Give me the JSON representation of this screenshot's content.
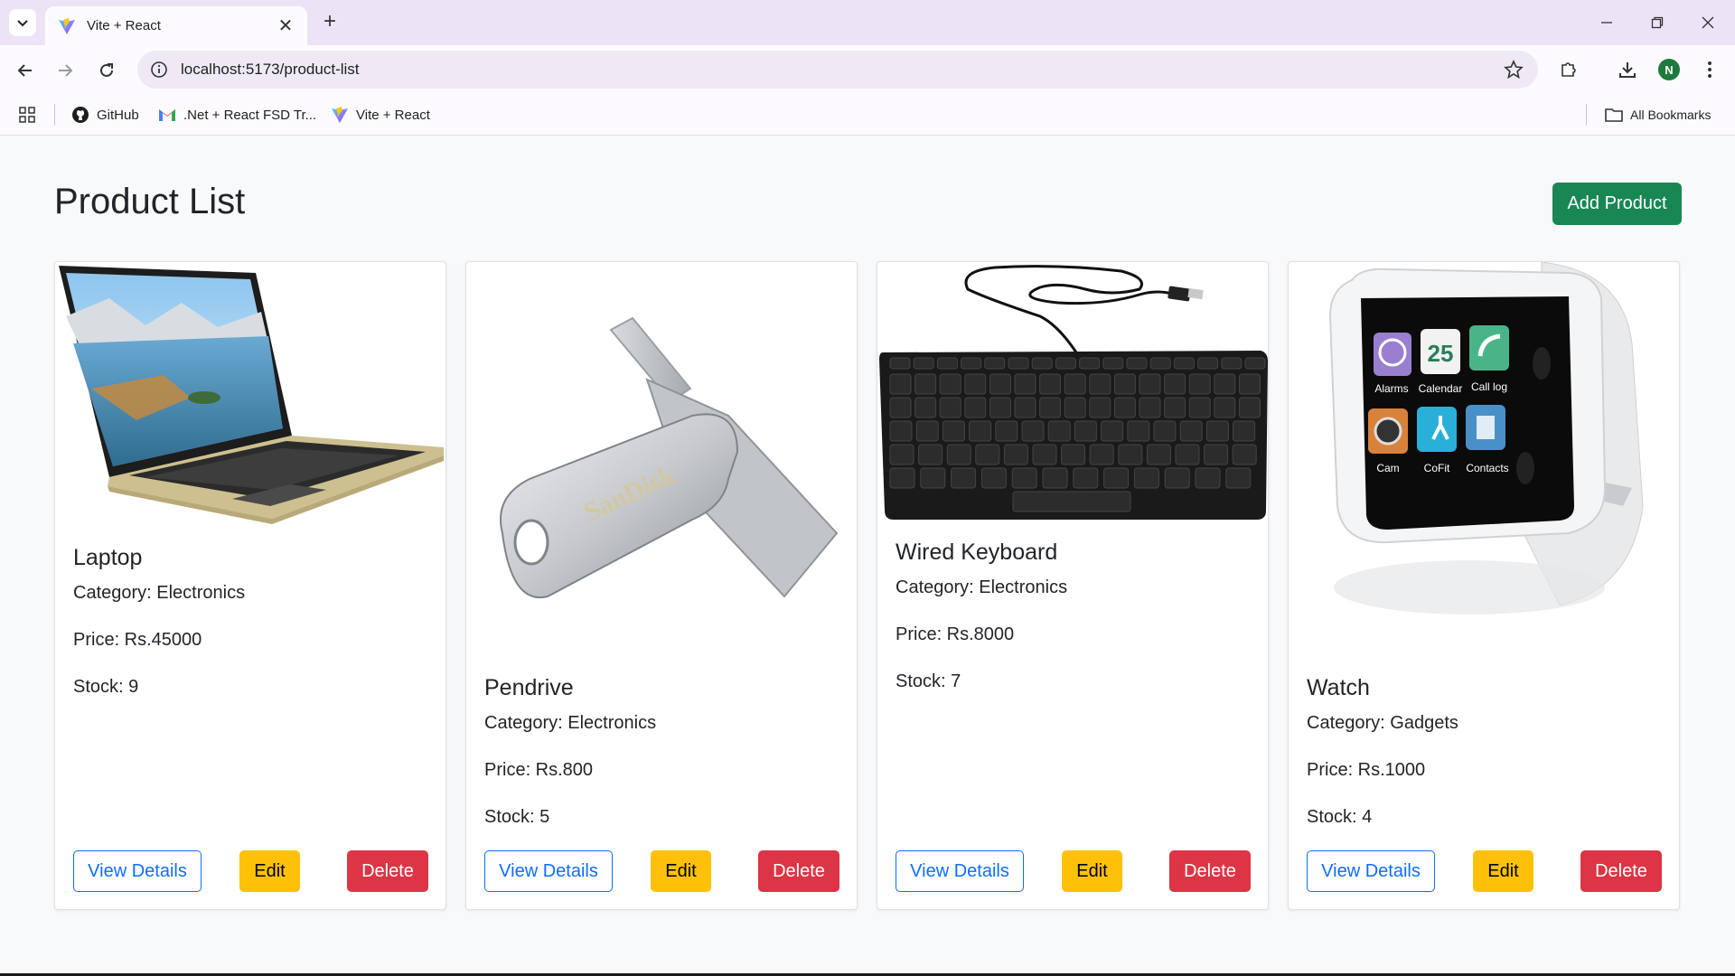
{
  "browser": {
    "tab_title": "Vite + React",
    "url": "localhost:5173/product-list",
    "profile_initial": "N",
    "bookmarks": [
      {
        "label": "GitHub",
        "icon": "github-icon"
      },
      {
        "label": ".Net + React FSD Tr...",
        "icon": "gmail-icon"
      },
      {
        "label": "Vite + React",
        "icon": "vite-icon"
      }
    ],
    "all_bookmarks_label": "All Bookmarks"
  },
  "page": {
    "title": "Product List",
    "add_button_label": "Add Product"
  },
  "products": [
    {
      "name": "Laptop",
      "category": "Category: Electronics",
      "price": "Price: Rs.45000",
      "stock": "Stock: 9",
      "image": "laptop-image"
    },
    {
      "name": "Pendrive",
      "category": "Category: Electronics",
      "price": "Price: Rs.800",
      "stock": "Stock: 5",
      "image": "pendrive-image"
    },
    {
      "name": "Wired Keyboard",
      "category": "Category: Electronics",
      "price": "Price: Rs.8000",
      "stock": "Stock: 7",
      "image": "keyboard-image"
    },
    {
      "name": "Watch",
      "category": "Category: Gadgets",
      "price": "Price: Rs.1000",
      "stock": "Stock: 4",
      "image": "smartwatch-image"
    }
  ],
  "card_buttons": {
    "view": "View Details",
    "edit": "Edit",
    "delete": "Delete"
  },
  "watch_apps": [
    "Alarms",
    "Calendar",
    "Call log",
    "Cam",
    "CoFit",
    "Contacts"
  ],
  "watch_calendar_day": "25",
  "pendrive_brand": "SanDisk",
  "colors": {
    "success": "#198754",
    "primary": "#0d6efd",
    "warning": "#ffc107",
    "danger": "#dc3545"
  }
}
